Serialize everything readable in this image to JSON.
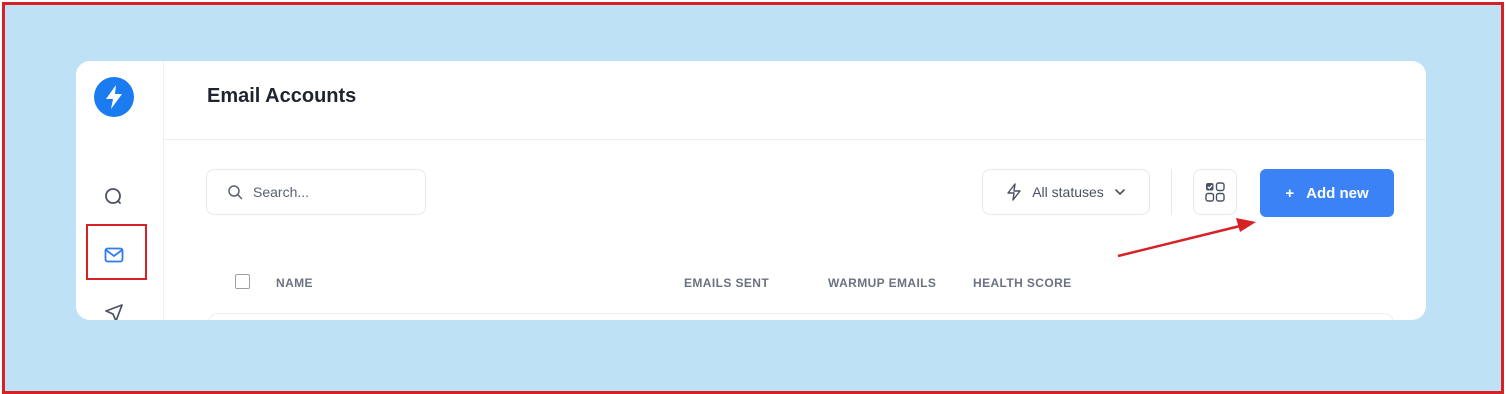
{
  "header": {
    "title": "Email Accounts"
  },
  "toolbar": {
    "search_placeholder": "Search...",
    "status_filter_label": "All statuses",
    "add_new_label": "Add new",
    "add_new_prefix": "+"
  },
  "table": {
    "columns": [
      "NAME",
      "EMAILS SENT",
      "WARMUP EMAILS",
      "HEALTH SCORE"
    ]
  },
  "sidebar": {
    "items": [
      {
        "icon": "search-icon"
      },
      {
        "icon": "mail-icon",
        "active": true
      },
      {
        "icon": "send-icon"
      }
    ]
  },
  "colors": {
    "background": "#bfe1f6",
    "accent": "#3b82f6",
    "logo": "#1a7cf0",
    "annotation": "#d82027"
  }
}
